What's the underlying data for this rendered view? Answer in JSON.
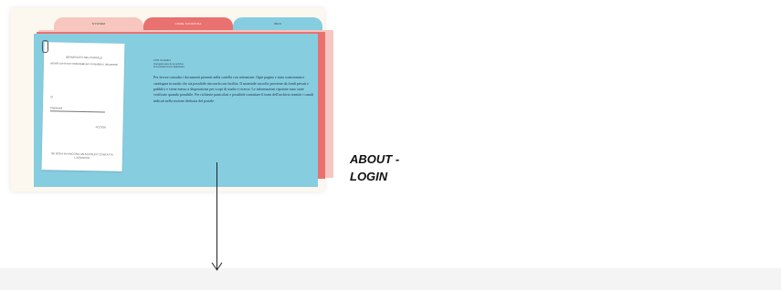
{
  "thumbnail": {
    "tabs": [
      {
        "label": "SYSTEM"
      },
      {
        "label": "COME FUNZIONA"
      },
      {
        "label": "INFO"
      }
    ],
    "login_card": {
      "heading": "BENVENUTO NEL PORTALE",
      "subtitle": "accedi con le tue credenziali per consultare i documenti",
      "field_label": "id",
      "field_value": "Password",
      "action_label": "ACCEDI",
      "footer": "SE NON HAI ANCORA UN ACCOUNT CONTATTA L'ARCHIVIO"
    },
    "content": {
      "heading": "CHI SIAMO",
      "meta_line_1": "Il progetto nasce da un archivio",
      "meta_line_2": "di documenti storici digitalizzati",
      "body": "Per favore consulta i documenti presenti nella cartella con attenzione. Ogni pagina e stata scansionata e catalogata in modo che sia possibile ritrovarla con facilita. Il materiale raccolto proviene da fondi privati e pubblici e viene messo a disposizione per scopi di studio e ricerca. Le informazioni riportate sono state verificate quando possibile. Per richieste particolari e possibile contattare il team dell'archivio tramite i canali indicati nella sezione dedicata del portale."
    },
    "colors": {
      "folder": "#87cde0",
      "tab_red": "#e9716f",
      "tab_pink": "#f6c6bf",
      "background": "#fdf8ef"
    }
  },
  "caption": {
    "line1": "ABOUT -",
    "line2": "LOGIN"
  },
  "arrow": {
    "direction": "down",
    "icon": "arrow-down-icon"
  }
}
